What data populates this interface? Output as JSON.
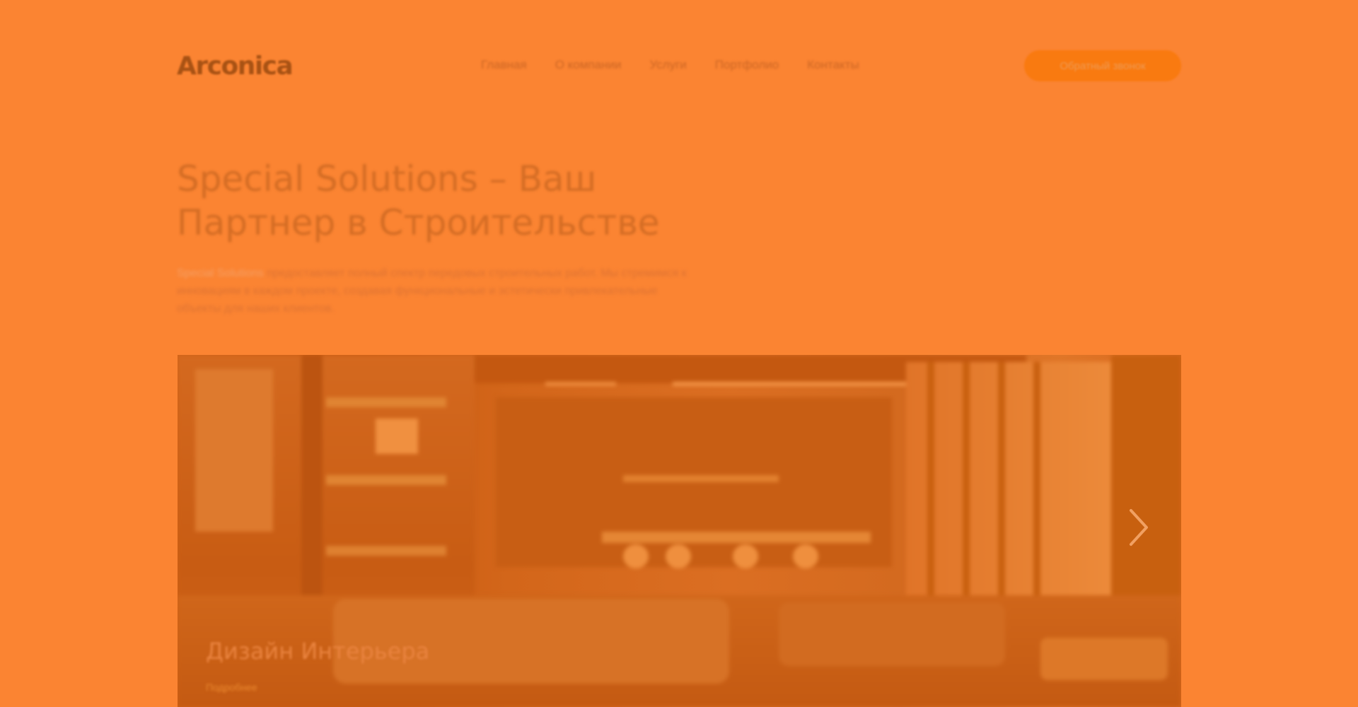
{
  "header": {
    "logo": "Arconica",
    "tagline": "",
    "nav": [
      {
        "label": "Главная"
      },
      {
        "label": "О компании"
      },
      {
        "label": "Услуги"
      },
      {
        "label": "Портфолио"
      },
      {
        "label": "Контакты"
      }
    ],
    "cta_label": "Обратный звонок"
  },
  "hero": {
    "title_line1": "Special Solutions – Ваш",
    "title_line2": "Партнер в Строительстве",
    "desc_accent": "Special Solutions",
    "desc_rest": " предоставляет полный спектр передовых строительных работ. Мы стремимся к инновациям в каждом проекте, создавая функциональные и эстетически привлекательные объекты для наших клиентов."
  },
  "slider": {
    "slide_title": "Дизайн Интерьера",
    "slide_link": "Подробнее",
    "next_icon": "chevron-right-icon"
  },
  "colors": {
    "background": "#fb8432",
    "accent": "#f97a10"
  }
}
